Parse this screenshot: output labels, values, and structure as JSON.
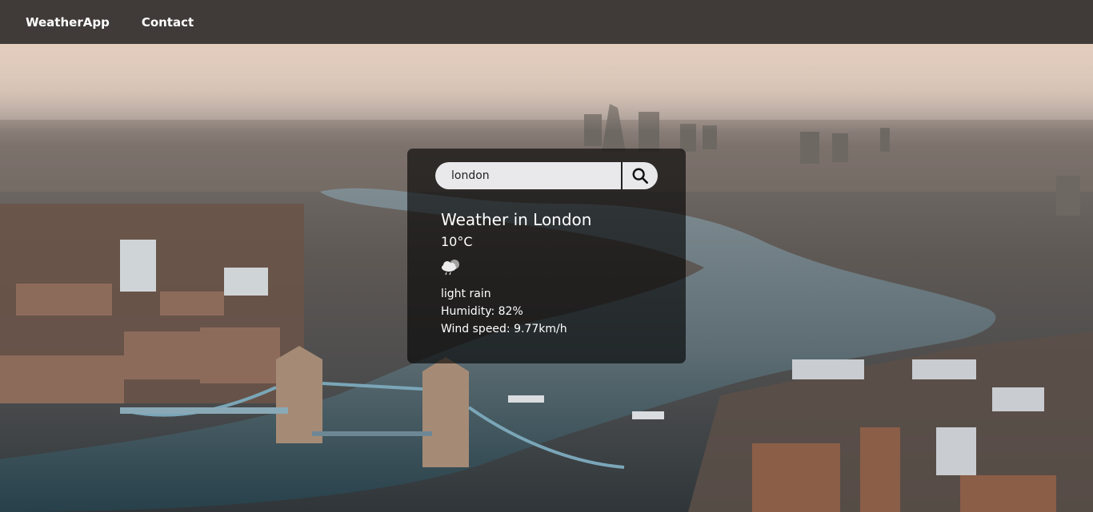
{
  "nav": {
    "brand": "WeatherApp",
    "contact": "Contact"
  },
  "search": {
    "value": "london",
    "button_icon": "search-icon"
  },
  "weather": {
    "title": "Weather in London",
    "temperature": "10°C",
    "icon": "cloud-rain-icon",
    "description": "light rain",
    "humidity": "Humidity: 82%",
    "wind": "Wind speed: 9.77km/h"
  },
  "colors": {
    "navbar": "#403b38",
    "card": "rgba(0,0,0,0.62)",
    "input_bg": "#e9e9ec"
  }
}
